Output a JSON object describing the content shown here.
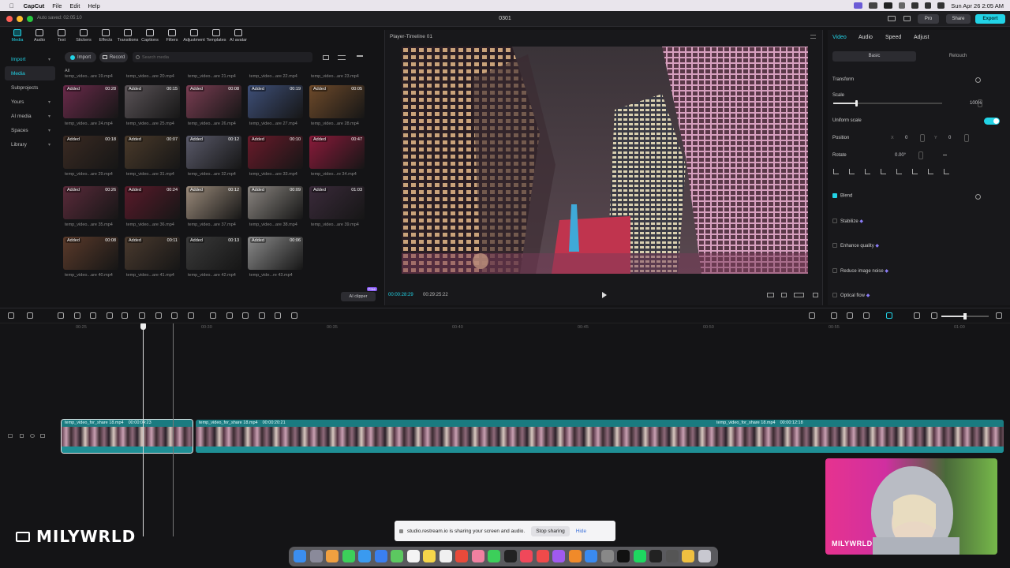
{
  "menubar": {
    "app": "CapCut",
    "items": [
      "File",
      "Edit",
      "Help"
    ],
    "clock": "Sun Apr 26  2:05 AM"
  },
  "window": {
    "title": "0301",
    "autosaved": "Auto saved: 02:05:10",
    "pro_label": "Pro",
    "share_label": "Share",
    "export_label": "Export"
  },
  "toolbar": {
    "tools": [
      "Media",
      "Audio",
      "Text",
      "Stickers",
      "Effects",
      "Transitions",
      "Captions",
      "Filters",
      "Adjustment",
      "Templates",
      "AI avatar"
    ]
  },
  "nav": {
    "items": [
      "Import",
      "Media",
      "Subprojects",
      "Yours",
      "AI media",
      "Spaces",
      "Library"
    ]
  },
  "media": {
    "import_label": "Import",
    "record_label": "Record",
    "search_placeholder": "Search media",
    "all_label": "All",
    "top_labels": [
      "temp_video...are 19.mp4",
      "temp_video...are 20.mp4",
      "temp_video...are 21.mp4",
      "temp_video...are 22.mp4",
      "temp_video...are 23.mp4"
    ],
    "items": [
      {
        "label": "temp_video...are 24.mp4",
        "badge": "Added",
        "duration": "00:28",
        "color": "#6a2a4a"
      },
      {
        "label": "temp_video...are 25.mp4",
        "badge": "Added",
        "duration": "00:15",
        "color": "#5b5458"
      },
      {
        "label": "temp_video...are 26.mp4",
        "badge": "Added",
        "duration": "00:08",
        "color": "#7a3d52"
      },
      {
        "label": "temp_video...are 27.mp4",
        "badge": "Added",
        "duration": "00:19",
        "color": "#3e4f78"
      },
      {
        "label": "temp_video...are 28.mp4",
        "badge": "Added",
        "duration": "00:05",
        "color": "#6e4a2a"
      },
      {
        "label": "temp_video...are 29.mp4",
        "badge": "Added",
        "duration": "00:18",
        "color": "#3a2a22"
      },
      {
        "label": "temp_video...are 31.mp4",
        "badge": "Added",
        "duration": "00:07",
        "color": "#4a3a2a"
      },
      {
        "label": "temp_video...are 32.mp4",
        "badge": "Added",
        "duration": "00:12",
        "color": "#5a5a6a"
      },
      {
        "label": "temp_video...are 33.mp4",
        "badge": "Added",
        "duration": "00:10",
        "color": "#6a1a2a"
      },
      {
        "label": "temp_video...re 34.mp4",
        "badge": "Added",
        "duration": "00:47",
        "color": "#8a1a3a"
      },
      {
        "label": "temp_video...are 35.mp4",
        "badge": "Added",
        "duration": "00:26",
        "color": "#5a2a3a"
      },
      {
        "label": "temp_video...are 36.mp4",
        "badge": "Added",
        "duration": "00:24",
        "color": "#5a1a2a"
      },
      {
        "label": "temp_video...are 37.mp4",
        "badge": "Added",
        "duration": "00:12",
        "color": "#9a8a7a"
      },
      {
        "label": "temp_video...are 38.mp4",
        "badge": "Added",
        "duration": "00:09",
        "color": "#8a8580"
      },
      {
        "label": "temp_video...are 39.mp4",
        "badge": "Added",
        "duration": "01:03",
        "color": "#3a2a3a"
      },
      {
        "label": "temp_video...are 40.mp4",
        "badge": "Added",
        "duration": "00:08",
        "color": "#5a3a2a"
      },
      {
        "label": "temp_video...are 41.mp4",
        "badge": "Added",
        "duration": "00:11",
        "color": "#4a3a2e"
      },
      {
        "label": "temp_video...are 42.mp4",
        "badge": "Added",
        "duration": "00:13",
        "color": "#3a3a3a"
      },
      {
        "label": "temp_vide...re 43.mp4",
        "badge": "Added",
        "duration": "00:06",
        "color": "#8a8a8a"
      }
    ],
    "ai_clipper_label": "AI clipper",
    "ai_clipper_badge": "Free"
  },
  "player": {
    "title": "Player-Timeline 01",
    "current_time": "00:00:28:29",
    "total_time": "00:29:25:22"
  },
  "props": {
    "tabs": [
      "Video",
      "Audio",
      "Speed",
      "Adjust"
    ],
    "subtabs": [
      "Basic",
      "Retouch"
    ],
    "transform_label": "Transform",
    "scale_label": "Scale",
    "scale_value": "100%",
    "uniform_scale_label": "Uniform scale",
    "position_label": "Position",
    "pos_x_label": "X",
    "pos_x": "0",
    "pos_y_label": "Y",
    "pos_y": "0",
    "rotate_label": "Rotate",
    "rotate_value": "0.00°",
    "blend_label": "Blend",
    "stabilize_label": "Stabilize",
    "enhance_label": "Enhance quality",
    "reduce_noise_label": "Reduce image noise",
    "optical_flow_label": "Optical flow",
    "scale_level": 0.2
  },
  "timeline": {
    "ruler": [
      "00:25",
      "00:30",
      "00:35",
      "00:40",
      "00:45",
      "00:50",
      "00:55",
      "01:00"
    ],
    "clips": [
      {
        "name": "temp_video_for_share 18.mp4",
        "time": "00:00:04:23"
      },
      {
        "name": "temp_video_for_share 18.mp4",
        "time": "00:00:20:21"
      },
      {
        "name": "temp_video_for_share 18.mp4",
        "time": "00:00:12:18"
      }
    ]
  },
  "share_bar": {
    "message": "studio.restream.io is sharing your screen and audio.",
    "stop_label": "Stop sharing",
    "hide_label": "Hide"
  },
  "watermark": {
    "text": "MILYWRLD"
  },
  "webcam": {
    "label": "MILYWRLD"
  },
  "colors": {
    "accent": "#22d3e6",
    "clip": "#1f6e73"
  }
}
